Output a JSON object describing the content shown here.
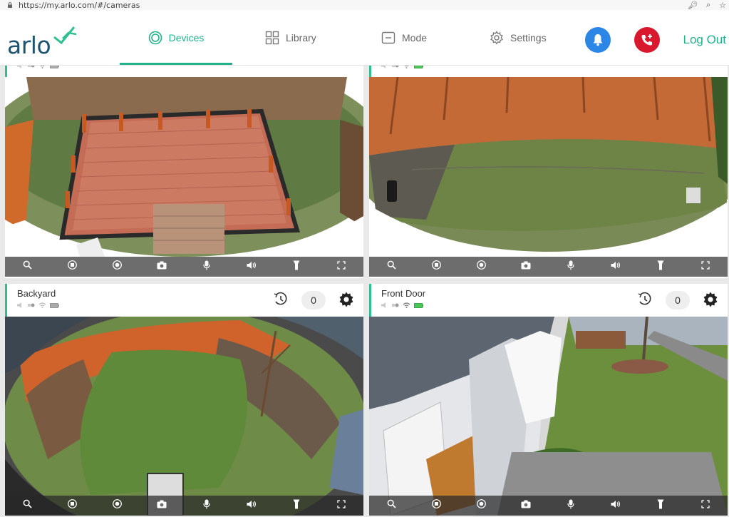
{
  "browser": {
    "url": "https://my.arlo.com/#/cameras"
  },
  "brand": {
    "logo_text": "arlo",
    "accent": "#1fb38a",
    "logo_color": "#1f5470"
  },
  "nav": {
    "devices": "Devices",
    "library": "Library",
    "mode": "Mode",
    "settings": "Settings",
    "logout": "Log Out"
  },
  "buttons": {
    "notifications_color": "#2b86e6",
    "emergency_color": "#d9182e"
  },
  "cameras": [
    {
      "name": "",
      "count": "",
      "signal": "good",
      "battery": "gray"
    },
    {
      "name": "",
      "count": "",
      "signal": "good",
      "battery": "green"
    },
    {
      "name": "Backyard",
      "count": "0",
      "signal": "good",
      "battery": "gray"
    },
    {
      "name": "Front Door",
      "count": "0",
      "signal": "good",
      "battery": "green"
    }
  ],
  "controls": [
    "zoom-icon",
    "stop-icon",
    "record-icon",
    "snapshot-icon",
    "microphone-icon",
    "volume-icon",
    "spotlight-icon",
    "fullscreen-icon"
  ]
}
